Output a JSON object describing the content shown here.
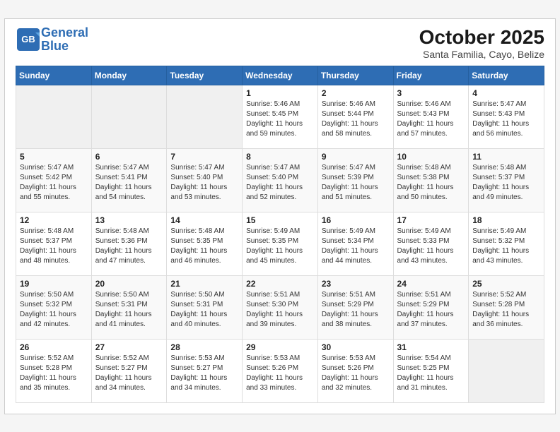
{
  "header": {
    "logo_line1": "General",
    "logo_line2": "Blue",
    "month_title": "October 2025",
    "location": "Santa Familia, Cayo, Belize"
  },
  "days_of_week": [
    "Sunday",
    "Monday",
    "Tuesday",
    "Wednesday",
    "Thursday",
    "Friday",
    "Saturday"
  ],
  "weeks": [
    [
      {
        "day": "",
        "info": ""
      },
      {
        "day": "",
        "info": ""
      },
      {
        "day": "",
        "info": ""
      },
      {
        "day": "1",
        "info": "Sunrise: 5:46 AM\nSunset: 5:45 PM\nDaylight: 11 hours\nand 59 minutes."
      },
      {
        "day": "2",
        "info": "Sunrise: 5:46 AM\nSunset: 5:44 PM\nDaylight: 11 hours\nand 58 minutes."
      },
      {
        "day": "3",
        "info": "Sunrise: 5:46 AM\nSunset: 5:43 PM\nDaylight: 11 hours\nand 57 minutes."
      },
      {
        "day": "4",
        "info": "Sunrise: 5:47 AM\nSunset: 5:43 PM\nDaylight: 11 hours\nand 56 minutes."
      }
    ],
    [
      {
        "day": "5",
        "info": "Sunrise: 5:47 AM\nSunset: 5:42 PM\nDaylight: 11 hours\nand 55 minutes."
      },
      {
        "day": "6",
        "info": "Sunrise: 5:47 AM\nSunset: 5:41 PM\nDaylight: 11 hours\nand 54 minutes."
      },
      {
        "day": "7",
        "info": "Sunrise: 5:47 AM\nSunset: 5:40 PM\nDaylight: 11 hours\nand 53 minutes."
      },
      {
        "day": "8",
        "info": "Sunrise: 5:47 AM\nSunset: 5:40 PM\nDaylight: 11 hours\nand 52 minutes."
      },
      {
        "day": "9",
        "info": "Sunrise: 5:47 AM\nSunset: 5:39 PM\nDaylight: 11 hours\nand 51 minutes."
      },
      {
        "day": "10",
        "info": "Sunrise: 5:48 AM\nSunset: 5:38 PM\nDaylight: 11 hours\nand 50 minutes."
      },
      {
        "day": "11",
        "info": "Sunrise: 5:48 AM\nSunset: 5:37 PM\nDaylight: 11 hours\nand 49 minutes."
      }
    ],
    [
      {
        "day": "12",
        "info": "Sunrise: 5:48 AM\nSunset: 5:37 PM\nDaylight: 11 hours\nand 48 minutes."
      },
      {
        "day": "13",
        "info": "Sunrise: 5:48 AM\nSunset: 5:36 PM\nDaylight: 11 hours\nand 47 minutes."
      },
      {
        "day": "14",
        "info": "Sunrise: 5:48 AM\nSunset: 5:35 PM\nDaylight: 11 hours\nand 46 minutes."
      },
      {
        "day": "15",
        "info": "Sunrise: 5:49 AM\nSunset: 5:35 PM\nDaylight: 11 hours\nand 45 minutes."
      },
      {
        "day": "16",
        "info": "Sunrise: 5:49 AM\nSunset: 5:34 PM\nDaylight: 11 hours\nand 44 minutes."
      },
      {
        "day": "17",
        "info": "Sunrise: 5:49 AM\nSunset: 5:33 PM\nDaylight: 11 hours\nand 43 minutes."
      },
      {
        "day": "18",
        "info": "Sunrise: 5:49 AM\nSunset: 5:32 PM\nDaylight: 11 hours\nand 43 minutes."
      }
    ],
    [
      {
        "day": "19",
        "info": "Sunrise: 5:50 AM\nSunset: 5:32 PM\nDaylight: 11 hours\nand 42 minutes."
      },
      {
        "day": "20",
        "info": "Sunrise: 5:50 AM\nSunset: 5:31 PM\nDaylight: 11 hours\nand 41 minutes."
      },
      {
        "day": "21",
        "info": "Sunrise: 5:50 AM\nSunset: 5:31 PM\nDaylight: 11 hours\nand 40 minutes."
      },
      {
        "day": "22",
        "info": "Sunrise: 5:51 AM\nSunset: 5:30 PM\nDaylight: 11 hours\nand 39 minutes."
      },
      {
        "day": "23",
        "info": "Sunrise: 5:51 AM\nSunset: 5:29 PM\nDaylight: 11 hours\nand 38 minutes."
      },
      {
        "day": "24",
        "info": "Sunrise: 5:51 AM\nSunset: 5:29 PM\nDaylight: 11 hours\nand 37 minutes."
      },
      {
        "day": "25",
        "info": "Sunrise: 5:52 AM\nSunset: 5:28 PM\nDaylight: 11 hours\nand 36 minutes."
      }
    ],
    [
      {
        "day": "26",
        "info": "Sunrise: 5:52 AM\nSunset: 5:28 PM\nDaylight: 11 hours\nand 35 minutes."
      },
      {
        "day": "27",
        "info": "Sunrise: 5:52 AM\nSunset: 5:27 PM\nDaylight: 11 hours\nand 34 minutes."
      },
      {
        "day": "28",
        "info": "Sunrise: 5:53 AM\nSunset: 5:27 PM\nDaylight: 11 hours\nand 34 minutes."
      },
      {
        "day": "29",
        "info": "Sunrise: 5:53 AM\nSunset: 5:26 PM\nDaylight: 11 hours\nand 33 minutes."
      },
      {
        "day": "30",
        "info": "Sunrise: 5:53 AM\nSunset: 5:26 PM\nDaylight: 11 hours\nand 32 minutes."
      },
      {
        "day": "31",
        "info": "Sunrise: 5:54 AM\nSunset: 5:25 PM\nDaylight: 11 hours\nand 31 minutes."
      },
      {
        "day": "",
        "info": ""
      }
    ]
  ]
}
